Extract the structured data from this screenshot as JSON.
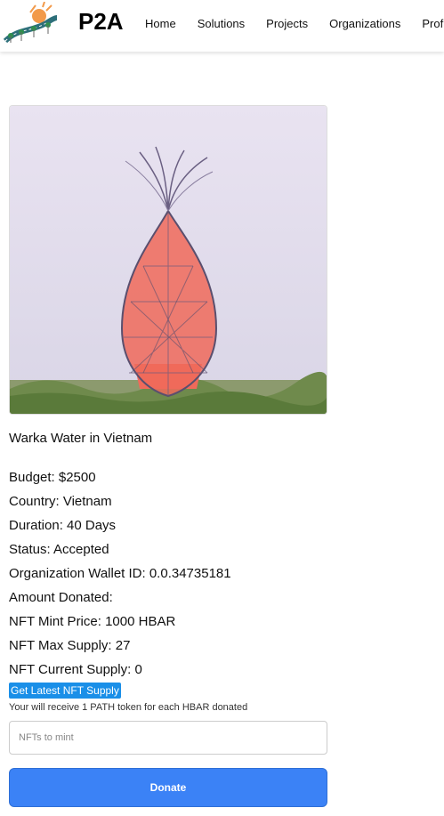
{
  "header": {
    "brand": "P2A",
    "nav": [
      "Home",
      "Solutions",
      "Projects",
      "Organizations",
      "Profile"
    ]
  },
  "project": {
    "title": "Warka Water in Vietnam",
    "image_alt": "Warka Water tower",
    "details": [
      "Budget: $2500",
      "Country: Vietnam",
      "Duration: 40 Days",
      "Status: Accepted",
      "Organization Wallet ID: 0.0.34735181",
      "Amount Donated:",
      "NFT Mint Price: 1000 HBAR",
      "NFT Max Supply: 27",
      "NFT Current Supply: 0"
    ]
  },
  "actions": {
    "supply_button": "Get Latest NFT Supply",
    "token_note": "Your will receive 1 PATH token for each HBAR donated",
    "mint_input_placeholder": "NFTs to mint",
    "mint_input_value": "",
    "donate_button": "Donate"
  },
  "colors": {
    "accent": "#3b82f6",
    "supply_button": "#1a8fe8"
  }
}
